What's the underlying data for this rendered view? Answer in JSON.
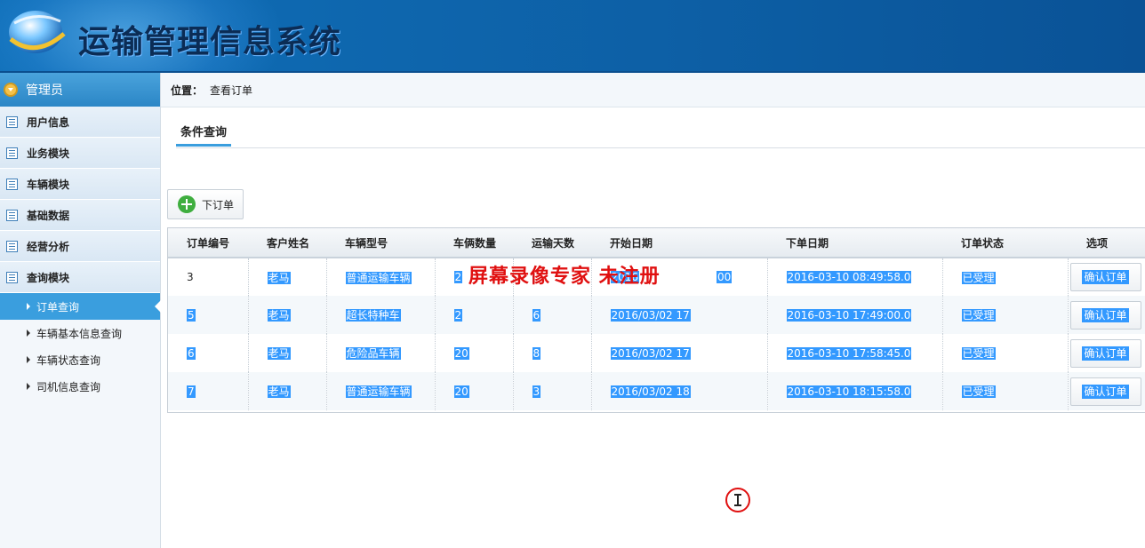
{
  "app": {
    "title": "运输管理信息系统"
  },
  "sidebar": {
    "user_role": "管理员",
    "menus": [
      {
        "label": "用户信息"
      },
      {
        "label": "业务模块"
      },
      {
        "label": "车辆模块"
      },
      {
        "label": "基础数据"
      },
      {
        "label": "经营分析"
      },
      {
        "label": "查询模块"
      }
    ],
    "submenu": [
      {
        "label": "订单查询",
        "active": true
      },
      {
        "label": "车辆基本信息查询"
      },
      {
        "label": "车辆状态查询"
      },
      {
        "label": "司机信息查询"
      }
    ]
  },
  "location": {
    "label": "位置：",
    "value": "查看订单"
  },
  "tabs": [
    {
      "label": "条件查询",
      "active": true
    }
  ],
  "toolbar": {
    "new_order_label": "下订单"
  },
  "table": {
    "headers": [
      "订单编号",
      "客户姓名",
      "车辆型号",
      "车俩数量",
      "运输天数",
      "开始日期",
      "下单日期",
      "订单状态",
      "选项"
    ],
    "rows": [
      {
        "id": "3",
        "customer": "老马",
        "model": "普通运输车辆",
        "qty": "2",
        "days": "",
        "start": "2016",
        "start_tail": "00",
        "ordered": "2016-03-10 08:49:58.0",
        "status": "已受理",
        "action": "确认订单"
      },
      {
        "id": "5",
        "customer": "老马",
        "model": "超长特种车",
        "qty": "2",
        "days": "6",
        "start": "2016/03/02 17",
        "ordered": "2016-03-10 17:49:00.0",
        "status": "已受理",
        "action": "确认订单"
      },
      {
        "id": "6",
        "customer": "老马",
        "model": "危险品车辆",
        "qty": "20",
        "days": "8",
        "start": "2016/03/02 17",
        "ordered": "2016-03-10 17:58:45.0",
        "status": "已受理",
        "action": "确认订单"
      },
      {
        "id": "7",
        "customer": "老马",
        "model": "普通运输车辆",
        "qty": "20",
        "days": "3",
        "start": "2016/03/02 18",
        "ordered": "2016-03-10 18:15:58.0",
        "status": "已受理",
        "action": "确认订单"
      }
    ]
  },
  "watermark": {
    "text": "屏幕录像专家  未注册"
  },
  "colors": {
    "header": "#0f6fb8",
    "accent": "#3a9ede",
    "selection": "#3399ff",
    "watermark": "#e01010"
  }
}
